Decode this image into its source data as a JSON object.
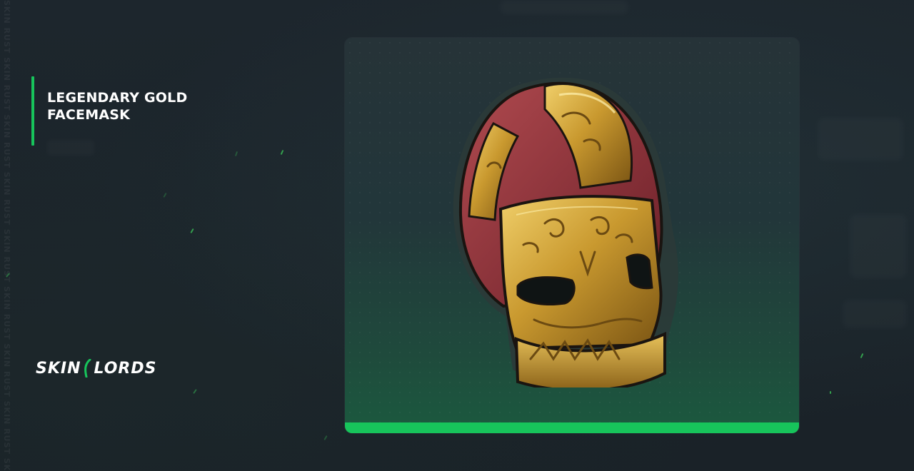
{
  "item": {
    "title_line1": "LEGENDARY GOLD",
    "title_line2": "FACEMASK",
    "image_icon": "gold-facemask-icon"
  },
  "brand": {
    "logo_text_left": "SKIN",
    "logo_text_right": "LORDS",
    "side_watermark": "SKIN RUST SKIN RUST SKIN RUST SKIN RUST SKIN RUST SKIN RUST SKIN RUST SKIN RUST SKIN RUST SKIN RUST"
  },
  "colors": {
    "accent": "#17c45b",
    "background": "#1b232a",
    "gold": "#c9992f",
    "mask_red": "#8a2d33"
  }
}
